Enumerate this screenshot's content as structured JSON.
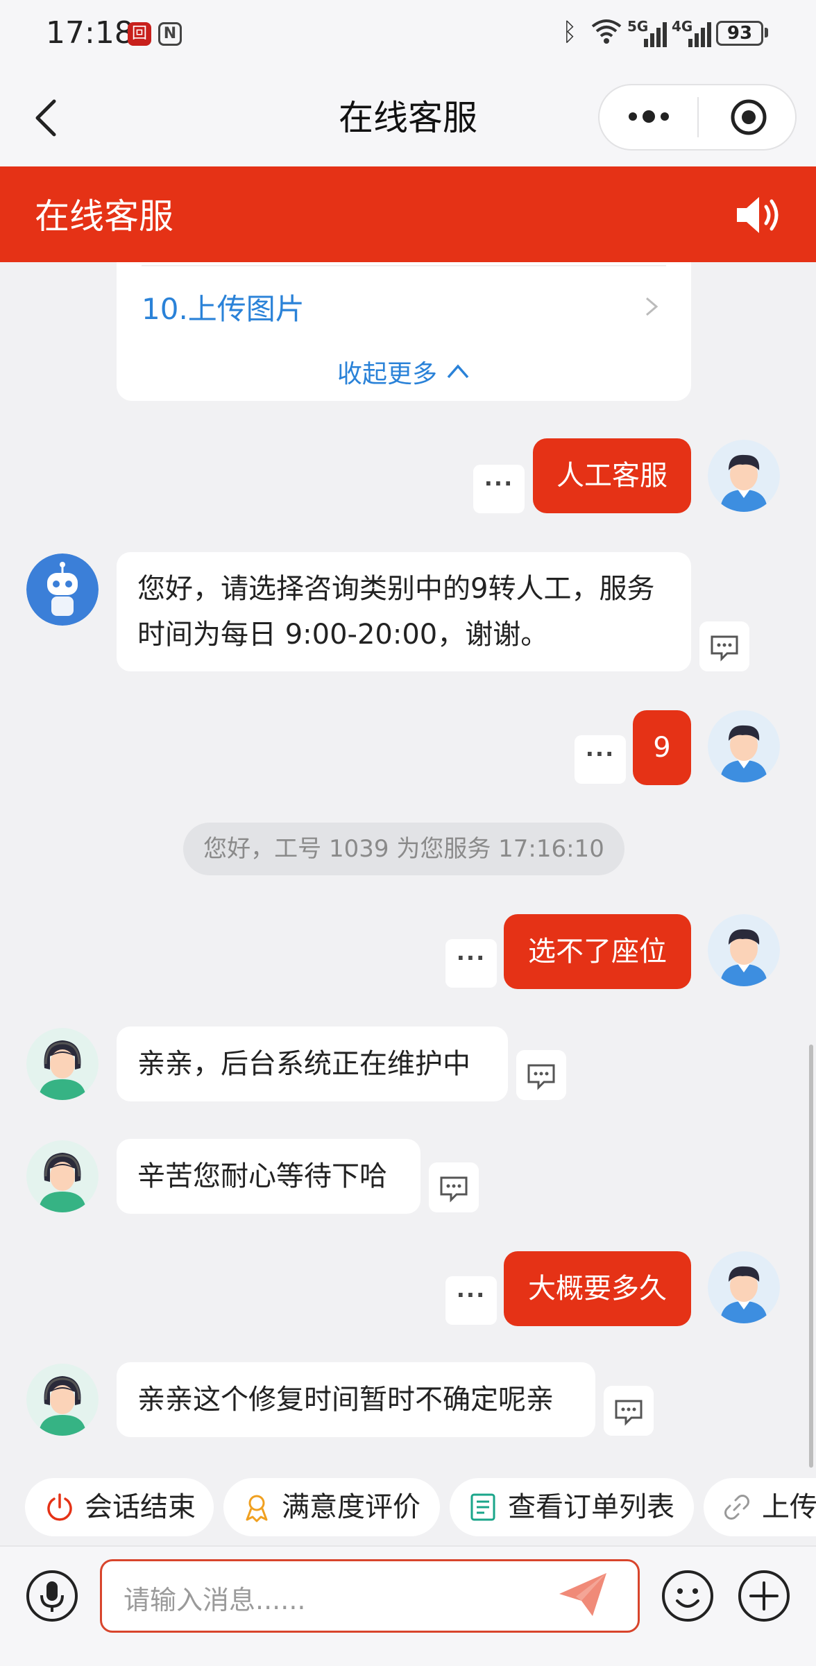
{
  "status_bar": {
    "time": "17:18",
    "network_5g": "5G",
    "network_4g": "4G",
    "battery": "93"
  },
  "nav": {
    "title": "在线客服"
  },
  "header": {
    "title": "在线客服",
    "icon": "speaker-icon"
  },
  "menu": {
    "item": "10.上传图片",
    "collapse_label": "收起更多"
  },
  "messages": {
    "m1": "人工客服",
    "m2": "您好，请选择咨询类别中的9转人工，服务时间为每日 9:00-20:00，谢谢。",
    "m3": "9",
    "system": "您好，工号 1039 为您服务 17:16:10",
    "m4": "选不了座位",
    "m5": "亲亲，后台系统正在维护中",
    "m6": "辛苦您耐心等待下哈",
    "m7": "大概要多久",
    "m8": "亲亲这个修复时间暂时不确定呢亲",
    "more_dots": "···"
  },
  "chips": [
    {
      "label": "会话结束",
      "icon": "power-icon",
      "color": "#e53216"
    },
    {
      "label": "满意度评价",
      "icon": "rating-icon",
      "color": "#f0a020"
    },
    {
      "label": "查看订单列表",
      "icon": "order-list-icon",
      "color": "#1aa58a"
    },
    {
      "label": "上传",
      "icon": "link-icon",
      "color": "#999999"
    }
  ],
  "input": {
    "placeholder": "请输入消息......"
  },
  "colors": {
    "accent": "#e53216",
    "link": "#2a82d8"
  }
}
